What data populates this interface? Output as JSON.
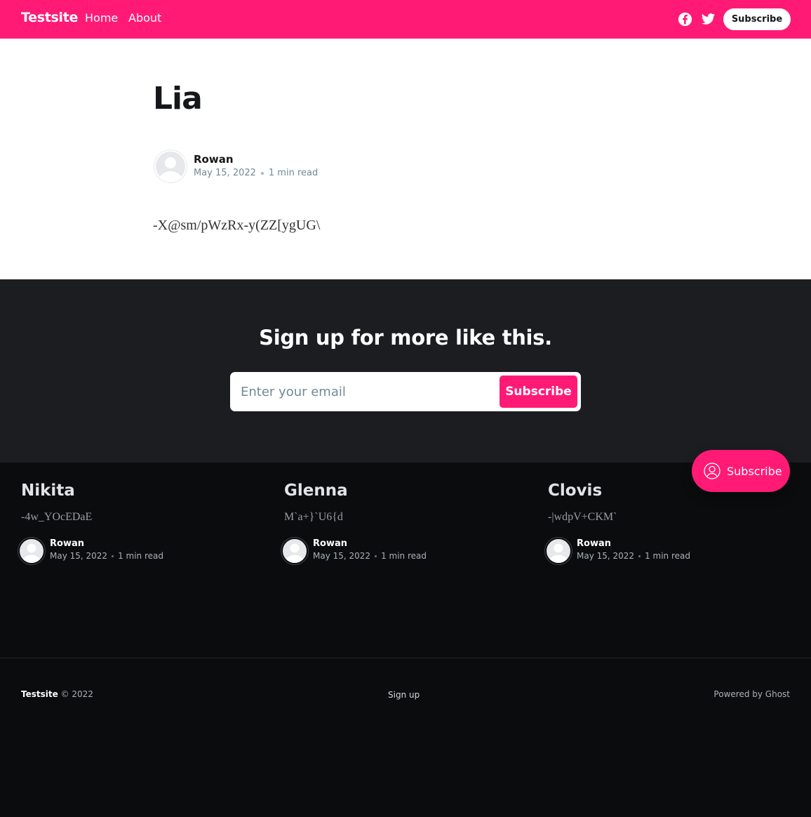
{
  "header": {
    "brand": "Testsite",
    "nav": [
      {
        "label": "Home"
      },
      {
        "label": "About"
      }
    ],
    "social": [
      {
        "icon": "facebook-icon"
      },
      {
        "icon": "twitter-icon"
      }
    ],
    "subscribe_label": "Subscribe"
  },
  "article": {
    "title": "Lia",
    "author": "Rowan",
    "date": "May 15, 2022",
    "reading_time": "1 min read",
    "body": "-X@sm/pWzRx-y(ZZ[ygUG\\"
  },
  "cta": {
    "title": "Sign up for more like this.",
    "email_placeholder": "Enter your email",
    "button_label": "Subscribe"
  },
  "related": [
    {
      "title": "Nikita",
      "excerpt": "-4w_YOcEDaE",
      "author": "Rowan",
      "date": "May 15, 2022",
      "reading_time": "1 min read"
    },
    {
      "title": "Glenna",
      "excerpt": "M`a+}`U6{d",
      "author": "Rowan",
      "date": "May 15, 2022",
      "reading_time": "1 min read"
    },
    {
      "title": "Clovis",
      "excerpt": "-|wdpV+CKM`",
      "author": "Rowan",
      "date": "May 15, 2022",
      "reading_time": "1 min read"
    }
  ],
  "footer": {
    "brand": "Testsite",
    "copyright": " © 2022",
    "signup": "Sign up",
    "powered": "Powered by Ghost"
  },
  "portal": {
    "label": "Subscribe",
    "icon": "user-circle-icon"
  },
  "colors": {
    "accent": "#ff1a75",
    "cta_background": "#1c1d21",
    "footer_background": "#0b0c0e"
  }
}
